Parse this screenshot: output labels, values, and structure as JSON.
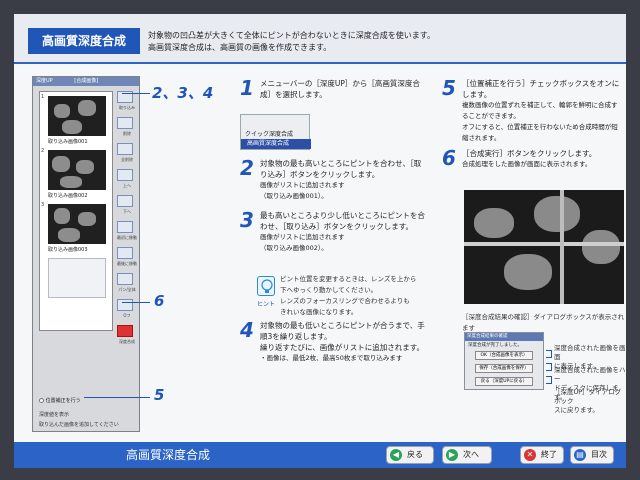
{
  "header": {
    "title": "高画質深度合成",
    "desc_line1": "対象物の凹凸差が大きくて全体にピントが合わないときに深度合成を使います。",
    "desc_line2": "高画質深度合成は、高画質の画像を作成できます。"
  },
  "app": {
    "window_title": "深度UP",
    "window_subtitle": "[合成画像]",
    "thumbs": [
      "取り込み画像001",
      "取り込み画像002",
      "取り込み画像003"
    ],
    "row_numbers": [
      "1",
      "2",
      "3"
    ],
    "tools": [
      "取り込み",
      "削除",
      "全削除",
      "上へ",
      "下へ",
      "最初に移動",
      "最後に移動",
      "パン/全体",
      "Oフ",
      "深度合成"
    ],
    "align_checkbox": "位置補正を行う",
    "footer_line1": "深度値を表示",
    "footer_line2": "取り込んだ画像を追加してください"
  },
  "callouts": {
    "c234": "2、3、4",
    "c6": "6",
    "c5": "5"
  },
  "steps": {
    "s1_no": "1",
    "s1_l1": "メニューバーの［深度UP］から［高画質深度合",
    "s1_l2": "成］を選択します。",
    "menu_item1": "クイック深度合成",
    "menu_item2": "高画質深度合成",
    "s2_no": "2",
    "s2_l1": "対象物の最も高いところにピントを合わせ、［取",
    "s2_l2": "り込み］ボタンをクリックします。",
    "s2_l3": "画像がリストに追加されます",
    "s2_l4": "（取り込み画像001）。",
    "s3_no": "3",
    "s3_l1": "最も高いところより少し低いところにピントを合",
    "s3_l2": "わせ、［取り込み］ボタンをクリックします。",
    "s3_l3": "画像がリストに追加されます",
    "s3_l4": "（取り込み画像002）。",
    "hint_label": "ヒント",
    "hint_l1": "ピント位置を変更するときは、レンズを上から",
    "hint_l2": "下へゆっくり動かしてください。",
    "hint_l3": "レンズのフォーカスリングで合わせるよりも",
    "hint_l4": "きれいな画像になります。",
    "s4_no": "4",
    "s4_l1": "対象物の最も低いところにピントが合うまで、手",
    "s4_l2": "順3を繰り返します。",
    "s4_l3": "繰り返すたびに、画像がリストに追加されます。",
    "s4_l4": "・画像は、最低2枚、最高50枚まで取り込みます",
    "s5_no": "5",
    "s5_l1": "［位置補正を行う］チェックボックスをオンにします。",
    "s5_l2": "複数画像の位置ずれを補正して、輪郭を鮮明に合成す",
    "s5_l3": "ることができます。",
    "s5_l4": "オフにすると、位置補正を行わないため合成時間が短",
    "s5_l5": "縮されます。",
    "s6_no": "6",
    "s6_l1": "［合成実行］ボタンをクリックします。",
    "s6_l2": "合成処理をした画像が画面に表示されます。",
    "dlg_caption": "［深度合成結果の確認］ダイアログボックスが表示されます",
    "dlg_title": "深度合成結果の確認",
    "dlg_msg": "深度合成が完了しました。",
    "dlg_btn1": "OK（合成画像を表示）",
    "dlg_btn2": "保存（合成画像を保存）",
    "dlg_btn3": "戻る（深度UPに戻る）",
    "note1_l1": "深度合成された画像を画面",
    "note1_l2": "に表示します。",
    "note2_l1": "深度合成された画像をハー",
    "note2_l2": "ドディスクに保存します。",
    "note3_l1": "［深度UP］ダイアログボック",
    "note3_l2": "スに戻ります。"
  },
  "footer": {
    "title": "高画質深度合成",
    "back": "戻る",
    "next": "次へ",
    "end": "終了",
    "toc": "目次"
  },
  "colors": {
    "accent": "#1f56b8",
    "bar": "#2b63c6"
  }
}
